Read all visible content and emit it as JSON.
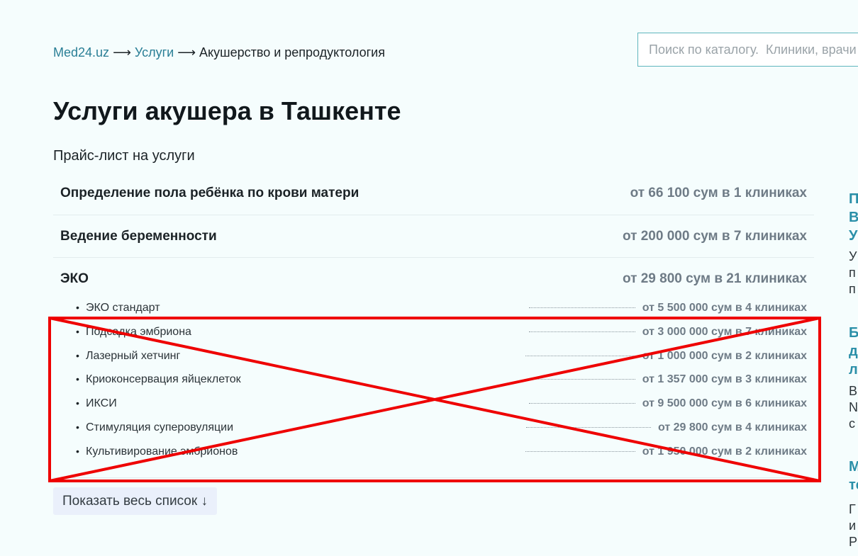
{
  "breadcrumb": {
    "home": "Med24.uz",
    "section": "Услуги",
    "current": "Акушерство и репродуктология",
    "separator": "⟶"
  },
  "search": {
    "placeholder": "Поиск по каталогу.  Клиники, врачи"
  },
  "page": {
    "title": "Услуги акушера в Ташкенте",
    "subtitle": "Прайс-лист на услуги"
  },
  "services": [
    {
      "name": "Определение пола ребёнка по крови матери",
      "price": "от 66 100 сум в 1 клиниках"
    },
    {
      "name": "Ведение беременности",
      "price": "от 200 000 сум в 7 клиниках"
    },
    {
      "name": "ЭКО",
      "price": "от 29 800 сум в 21 клиниках",
      "items": [
        {
          "name": "ЭКО стандарт",
          "price": "от 5 500 000 сум в 4 клиниках"
        },
        {
          "name": "Подсадка эмбриона",
          "price": "от 3 000 000 сум в 7 клиниках"
        },
        {
          "name": "Лазерный хетчинг",
          "price": "от 1 000 000 сум в 2 клиниках"
        },
        {
          "name": "Криоконсервация яйцеклеток",
          "price": "от 1 357 000 сум в 3 клиниках"
        },
        {
          "name": "ИКСИ",
          "price": "от 9 500 000 сум в 6 клиниках"
        },
        {
          "name": "Стимуляция суперовуляции",
          "price": "от 29 800 сум в 4 клиниках"
        },
        {
          "name": "Культивирование эмбрионов",
          "price": "от 1 950 000 сум в 2 клиниках"
        }
      ]
    }
  ],
  "show_all_label": "Показать весь список ↓",
  "sidebar": {
    "article1_title": "П\nВ\nУ",
    "article1_text": "У\nп\nп",
    "article2_title": "Б\nд\nл",
    "article2_text": "В\nN\nс",
    "article3_title": "М\nте",
    "article3_text": "Г\nи\nР"
  },
  "colors": {
    "link": "#2a7f96",
    "accent": "#2a8fa8",
    "price": "#6e7b86",
    "annotation": "#ee0000"
  }
}
